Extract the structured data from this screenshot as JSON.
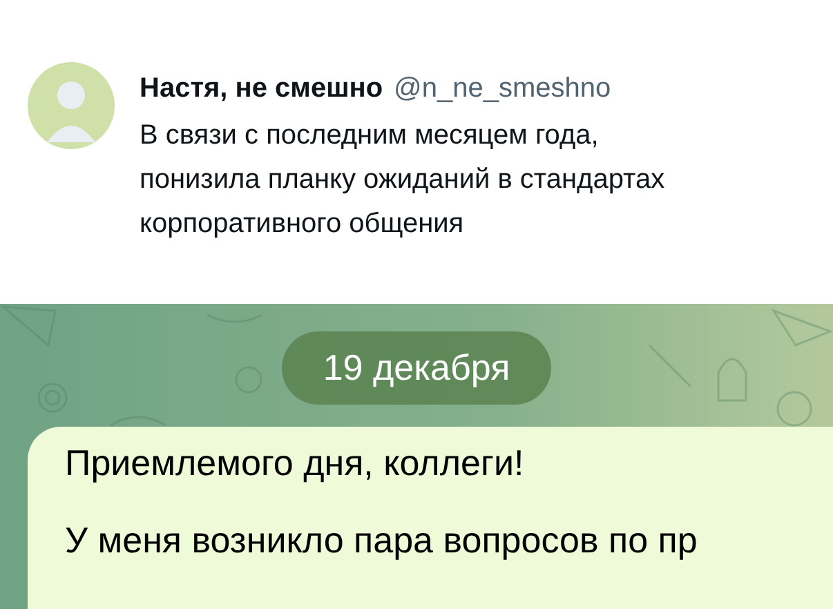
{
  "tweet": {
    "author": "Настя, не смешно",
    "handle": "@n_ne_smeshno",
    "text": "В связи с последним месяцем года, понизила планку ожиданий в стандартах корпоративного общения"
  },
  "chat": {
    "date": "19 декабря",
    "message": {
      "greeting": "Приемлемого дня, коллеги!",
      "body": "У меня возникло пара вопросов по пр"
    }
  }
}
